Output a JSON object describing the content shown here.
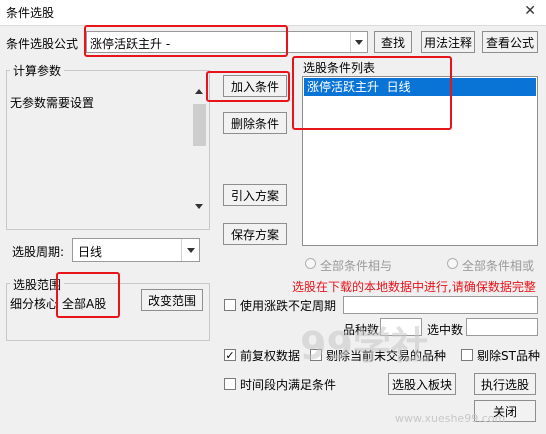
{
  "window": {
    "title": "条件选股",
    "close_glyph": "✕"
  },
  "formula": {
    "label": "条件选股公式",
    "value": "涨停活跃主升 -"
  },
  "buttons": {
    "find": "查找",
    "usage": "用法注释",
    "view_formula": "查看公式",
    "add_condition": "加入条件",
    "delete_condition": "删除条件",
    "import_plan": "引入方案",
    "save_plan": "保存方案",
    "change_scope": "改变范围",
    "select_to_block": "选股入板块",
    "execute": "执行选股",
    "close": "关闭"
  },
  "params": {
    "group_title": "计算参数",
    "text": "无参数需要设置"
  },
  "period": {
    "label": "选股周期:",
    "value": "日线"
  },
  "conditions": {
    "group_title": "选股条件列表",
    "items": [
      "涨停活跃主升  日线"
    ]
  },
  "logic": {
    "and_label": "全部条件相与",
    "or_label": "全部条件相或"
  },
  "notice": {
    "text": "选股在下载的本地数据中进行,请确保数据完整",
    "color": "#e8141c"
  },
  "range": {
    "group_title": "选股范围",
    "prefix": "细分核心",
    "value": "全部A股"
  },
  "options": {
    "use_uncertain_period": "使用涨跌不定周期",
    "count_label": "品种数",
    "selected_label": "选中数",
    "pre_adjust": "前复权数据",
    "exclude_suspended": "剔除当前未交易的品种",
    "exclude_st": "剔除ST品种",
    "time_range_satisfy": "时间段内满足条件"
  },
  "watermark": {
    "brand": "99学社",
    "url": "www.xueshe99.com"
  }
}
